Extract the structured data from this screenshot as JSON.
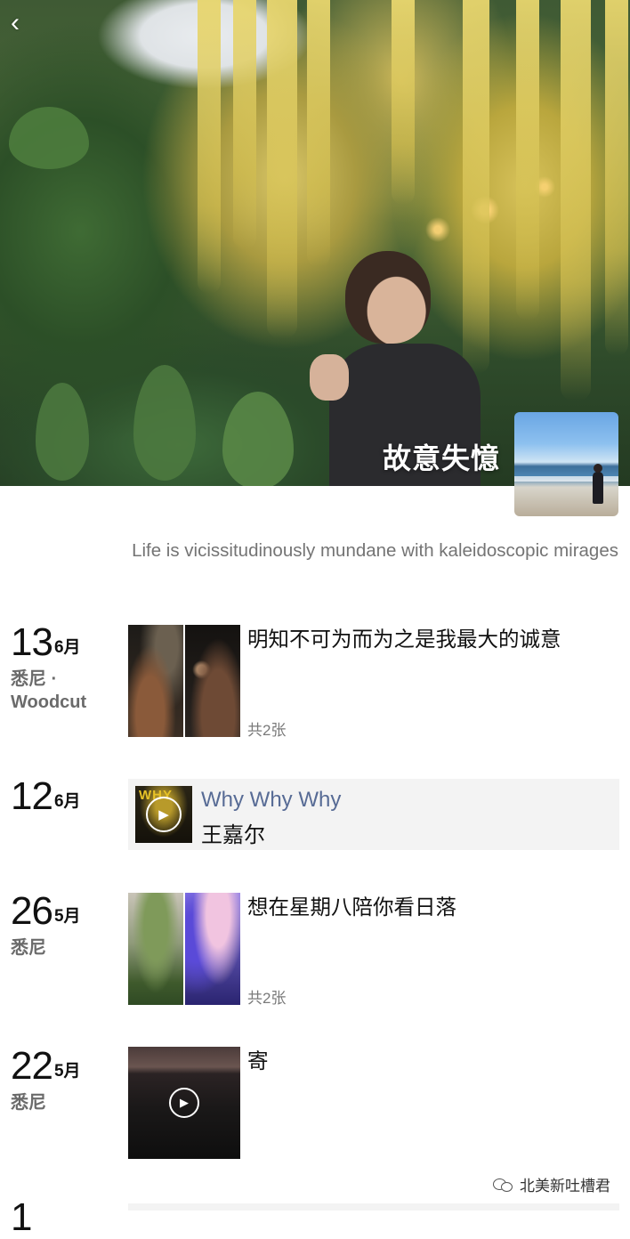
{
  "profile": {
    "username": "故意失憶",
    "signature": "Life is vicissitudinously mundane with kaleidoscopic mirages"
  },
  "posts": [
    {
      "day": "13",
      "month": "6月",
      "location": "悉尼 · Woodcut",
      "caption": "明知不可为而为之是我最大的诚意",
      "count": "共2张"
    },
    {
      "day": "12",
      "month": "6月",
      "music": {
        "title": "Why Why Why",
        "artist": "王嘉尔",
        "cover_text": "WHY"
      }
    },
    {
      "day": "26",
      "month": "5月",
      "location": "悉尼",
      "caption": "想在星期八陪你看日落",
      "count": "共2张"
    },
    {
      "day": "22",
      "month": "5月",
      "location": "悉尼",
      "caption": "寄"
    }
  ],
  "watermark": {
    "text": "北美新吐槽君"
  },
  "icons": {
    "back": "chevron-left-icon",
    "play": "play-icon",
    "wechat": "wechat-icon"
  },
  "colors": {
    "link": "#576b95",
    "card_bg": "#f3f3f3",
    "meta": "#6b6b6b"
  }
}
